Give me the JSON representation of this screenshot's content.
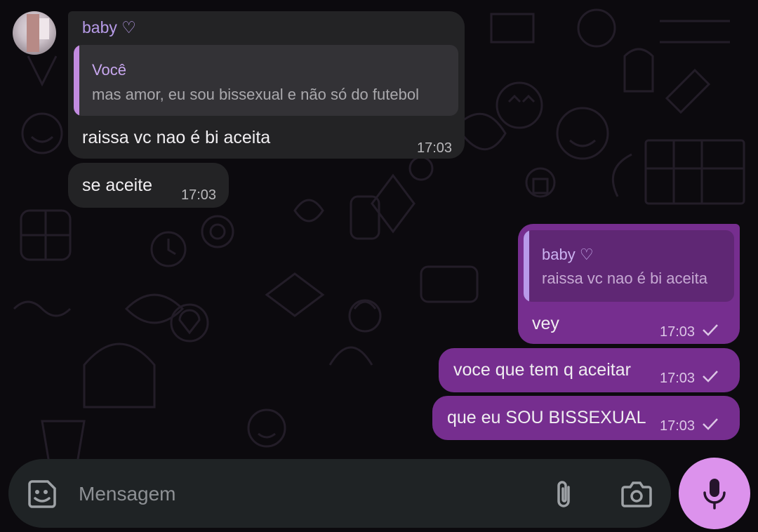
{
  "chat": {
    "messages": [
      {
        "sender": "baby ♡",
        "quote_name": "Você",
        "quote_text": "mas amor, eu sou bissexual e não só do futebol",
        "text": "raissa vc nao é bi aceita",
        "time": "17:03"
      },
      {
        "text": "se aceite",
        "time": "17:03"
      },
      {
        "quote_name": "baby ♡",
        "quote_text": "raissa vc nao é bi aceita",
        "text": "vey",
        "time": "17:03"
      },
      {
        "text": "voce que tem q aceitar",
        "time": "17:03"
      },
      {
        "text": "que eu SOU BISSEXUAL",
        "time": "17:03"
      }
    ]
  },
  "composer": {
    "placeholder": "Mensagem",
    "emoji_icon": "sticker-emoji-icon",
    "attach_icon": "paperclip-icon",
    "camera_icon": "camera-icon",
    "mic_icon": "microphone-icon"
  },
  "colors": {
    "background": "#0c0a0e",
    "incoming_bubble": "#232325",
    "outgoing_bubble": "#762e8f",
    "sender_name": "#b79be8",
    "mic_button": "#dc92ec"
  }
}
